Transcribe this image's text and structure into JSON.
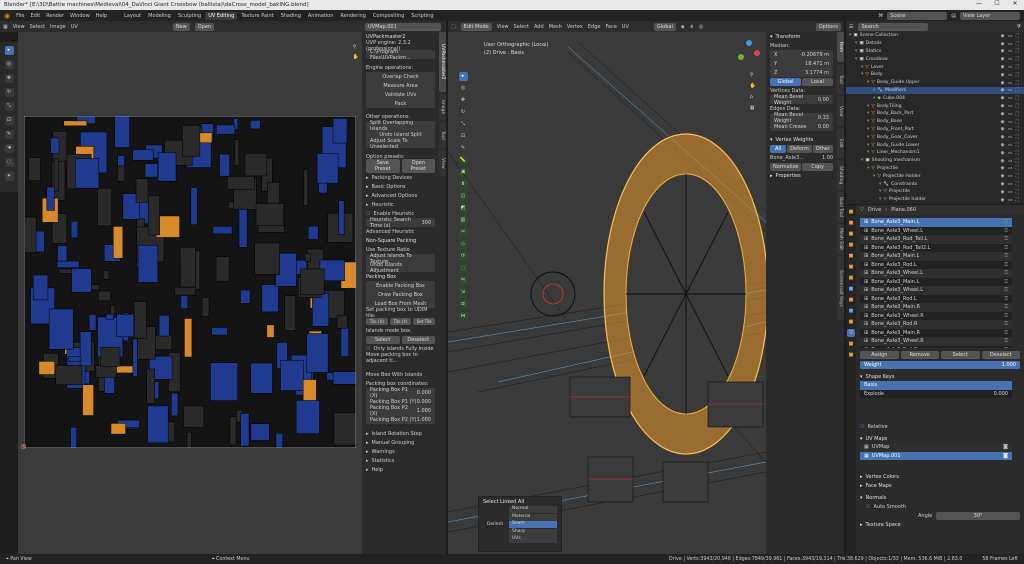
{
  "window_title": "Blender* [E:\\3D\\Battle machines\\Medieval\\04_DaVinci Giant Crossbow (ballista)\\daCross_model_bakING.blend]",
  "window_controls": [
    "—",
    "☐",
    "✕"
  ],
  "topbar": {
    "menus": [
      "File",
      "Edit",
      "Render",
      "Window",
      "Help"
    ],
    "workspaces": [
      "Layout",
      "Modeling",
      "Sculpting",
      "UV Editing",
      "Texture Paint",
      "Shading",
      "Animation",
      "Rendering",
      "Compositing",
      "Scripting"
    ],
    "active_workspace": "UV Editing",
    "scene_label": "Scene",
    "view_layer_label": "View Layer"
  },
  "uv_editor": {
    "header": [
      "UV Editor",
      "View",
      "Select",
      "Image",
      "UV"
    ],
    "new_label": "New",
    "open_label": "Open",
    "image_name": "UVMap.001"
  },
  "packer": {
    "title": "UVPackmaster2",
    "engine_line": "UVP engine: 2.3.2 (professional)",
    "program_path": "C:\\Program Files\\UVPackm...",
    "engine_ops_label": "Engine operations:",
    "engine_ops": [
      "Overlap Check",
      "Measure Area",
      "Validate UVs",
      "Pack"
    ],
    "other_ops_label": "Other operations:",
    "other_ops": [
      "Split Overlapping Islands",
      "Undo Island Split",
      "Adjust Scale To Unselected"
    ],
    "presets_label": "Option presets:",
    "save_preset": "Save Preset",
    "open_preset": "Open Preset",
    "sections": [
      "Packing Devices",
      "Basic Options",
      "Advanced Options",
      "Heuristic"
    ],
    "enable_heuristic": "Enable Heuristic",
    "heuristic_time": "Heuristic Search Time (s)",
    "heuristic_time_value": "300",
    "advanced_heuristic": "Advanced Heuristic",
    "non_square": "Non-Square Packing",
    "use_texture_ratio": "Use Texture Ratio",
    "adjust_islands": "Adjust Islands To Texture",
    "undo_islands": "Undo Islands Adjustment",
    "packing_box": "Packing Box",
    "enable_packing_box": "Enable Packing Box",
    "draw_packing_box": "Draw Packing Box",
    "load_box": "Load Box From Mesh",
    "set_packing_box": "Set packing box to UDIM tile:",
    "tile_buttons": [
      "Tile (X)",
      "Tile (Y)",
      "Set Tile"
    ],
    "islands_mode": "Islands mode box:",
    "select_label": "Select",
    "deselect_label": "Deselect",
    "only_islands": "Only Islands Fully Inside",
    "move_box": "Move packing box to adjacent ti...",
    "move_box_island": "Move Box With Islands",
    "packing_box_coords": "Packing box coordinates:",
    "box_coords": [
      {
        "label": "Packing Box P1 (X)",
        "value": "0.000"
      },
      {
        "label": "Packing Box P1 (Y)",
        "value": "0.000"
      },
      {
        "label": "Packing Box P2 (X)",
        "value": "1.000"
      },
      {
        "label": "Packing Box P2 (Y)",
        "value": "1.000"
      }
    ],
    "bottom_sections": [
      "Island Rotation Step",
      "Manual Grouping",
      "Warnings",
      "Statistics",
      "Help"
    ],
    "vertical_tabs": [
      "UVPackmaster2",
      "Image",
      "Tool",
      "View"
    ]
  },
  "viewport": {
    "header": [
      "Edit Mode",
      "View",
      "Select",
      "Add",
      "Mesh",
      "Vertex",
      "Edge",
      "Face",
      "UV"
    ],
    "transform_orient": "Global",
    "options_label": "Options",
    "view_name": "User Orthographic (Local)",
    "object_info": "(2) Drive : Basis",
    "vertical_tabs": [
      "Item",
      "Tool",
      "View",
      "Edit",
      "Shading",
      "Bool Tool",
      "Mesh Edit",
      "Screencast Keys"
    ]
  },
  "transform": {
    "title": "Transform",
    "median": "Median:",
    "fields": [
      {
        "axis": "X",
        "value": "-0.20679 m"
      },
      {
        "axis": "Y",
        "value": "18.471 m"
      },
      {
        "axis": "Z",
        "value": "3.1774 m"
      }
    ],
    "global": "Global",
    "local": "Local",
    "vertices_data": "Vertices Data:",
    "mean_bevel_weight": "Mean Bevel Weight",
    "mbw_value": "0.00",
    "edges_data": "Edges Data:",
    "edge_bevel": "Mean Bevel Weight",
    "edge_bevel_value": "0.33",
    "mean_crease": "Mean Crease",
    "mean_crease_value": "0.00"
  },
  "vertex_weights": {
    "title": "Vertex Weights",
    "tabs": [
      "All",
      "Deform",
      "Other"
    ],
    "bone_row": "Bone_Axle3...",
    "bone_value": "1.00",
    "normalize": "Normalize",
    "copy": "Copy",
    "properties": "Properties"
  },
  "tools": [
    "select",
    "cursor",
    "move",
    "rotate",
    "scale",
    "transform",
    "annotate",
    "measure",
    "add-cube",
    "extrude",
    "inset",
    "bevel",
    "loop-cut",
    "knife",
    "poly-build",
    "spin",
    "smooth",
    "edge-slide",
    "shrink",
    "shear",
    "rip"
  ],
  "outliner": {
    "search": "Search",
    "items": [
      {
        "indent": 0,
        "label": "Scene Collection",
        "kind": "coll"
      },
      {
        "indent": 1,
        "label": "Details",
        "kind": "coll"
      },
      {
        "indent": 1,
        "label": "Statics",
        "kind": "coll"
      },
      {
        "indent": 1,
        "label": "Crossbow",
        "kind": "coll"
      },
      {
        "indent": 2,
        "label": "Lever",
        "kind": "obj"
      },
      {
        "indent": 2,
        "label": "Body",
        "kind": "obj"
      },
      {
        "indent": 3,
        "label": "Body_Guide.Upper",
        "kind": "obj"
      },
      {
        "indent": 4,
        "label": "Modifiers",
        "kind": "mod"
      },
      {
        "indent": 4,
        "label": "Cube.004",
        "kind": "mesh"
      },
      {
        "indent": 3,
        "label": "Body.Tiling",
        "kind": "obj"
      },
      {
        "indent": 3,
        "label": "Body_Back_Part",
        "kind": "obj"
      },
      {
        "indent": 3,
        "label": "Body_Base",
        "kind": "obj"
      },
      {
        "indent": 3,
        "label": "Body_Front_Part",
        "kind": "obj"
      },
      {
        "indent": 3,
        "label": "Body_Gear_Cover",
        "kind": "obj"
      },
      {
        "indent": 3,
        "label": "Body_Guide.Lower",
        "kind": "obj"
      },
      {
        "indent": 3,
        "label": "Liner_Mechanism1",
        "kind": "obj"
      },
      {
        "indent": 2,
        "label": "Shooting mechanism",
        "kind": "coll"
      },
      {
        "indent": 3,
        "label": "Projectile",
        "kind": "obj"
      },
      {
        "indent": 4,
        "label": "Projectile Holder",
        "kind": "obj"
      },
      {
        "indent": 5,
        "label": "Constraints",
        "kind": "mod"
      },
      {
        "indent": 5,
        "label": "Projectile",
        "kind": "obj"
      },
      {
        "indent": 5,
        "label": "Projectile holder",
        "kind": "obj"
      }
    ]
  },
  "properties": {
    "object": "Drive",
    "mesh": "Plane.060",
    "vertex_groups": [
      "Bone_Axle3_Main.L",
      "Bone_Axle3_Wheel.L",
      "Bone_Axle3_Rod_Tail.L",
      "Bone_Axle3_Rod_Tail2.L",
      "Bone_Axle3_Main.L",
      "Bone_Axle3_Rod.L",
      "Bone_Axle3_Wheel.L",
      "Bone_Axle3_Main.L",
      "Bone_Axle3_Wheel.L",
      "Bone_Axle3_Rod.L",
      "Bone_Axle3_Main.R",
      "Bone_Axle3_Wheel.R",
      "Bone_Axle3_Rod.R",
      "Bone_Axle3_Main.R",
      "Bone_Axle3_Wheel.R",
      "Bone_Axle3_Rod.R"
    ],
    "assign": "Assign",
    "remove": "Remove",
    "select": "Select",
    "deselect": "Deselect",
    "weight_label": "Weight",
    "weight_value": "1.000",
    "shape_keys": "Shape Keys",
    "shape_key_items": [
      {
        "name": "Basis",
        "value": ""
      },
      {
        "name": "Explode",
        "value": "0.000"
      }
    ],
    "relative": "Relative",
    "uv_maps": "UV Maps",
    "uv_map_items": [
      "UVMap",
      "UVMap.001"
    ],
    "vertex_colors": "Vertex Colors",
    "face_maps": "Face Maps",
    "normals": "Normals",
    "auto_smooth": "Auto Smooth",
    "angle_label": "Angle",
    "angle_value": "30°",
    "texture_space": "Texture Space"
  },
  "select_linked": {
    "title": "Select Linked All",
    "delimit_label": "Delimit",
    "options": [
      "Normal",
      "Material",
      "Seam",
      "Sharp",
      "UVs"
    ],
    "active": "Seam"
  },
  "statusbar": {
    "left": [
      "Pan View",
      "Context Menu"
    ],
    "right": "Drive | Verts:3943/20,946 | Edges:7849/39,961 | Faces:3943/19,314 | Tris:38,629 | Objects:1/33 | Mem: 536.6 MiB | 2.83.0",
    "fps": "58 Frames Left"
  }
}
